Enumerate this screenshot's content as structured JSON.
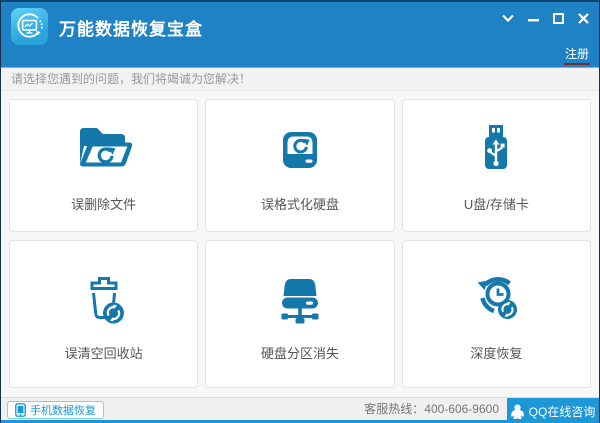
{
  "window": {
    "title": "万能数据恢复宝盒"
  },
  "titlebar": {
    "register_label": "注册",
    "controls": {
      "dropdown": "chevron-down",
      "minimize": "minimize",
      "maximize": "maximize",
      "close": "close"
    }
  },
  "notice": {
    "text": "请选择您遇到的问题，我们将竭诚为您解决！"
  },
  "cards": [
    {
      "label": "误删除文件",
      "icon": "folder-recover-icon"
    },
    {
      "label": "误格式化硬盘",
      "icon": "hdd-format-icon"
    },
    {
      "label": "U盘/存储卡",
      "icon": "usb-drive-icon"
    },
    {
      "label": "误清空回收站",
      "icon": "recycle-bin-recover-icon"
    },
    {
      "label": "硬盘分区消失",
      "icon": "partition-lost-icon"
    },
    {
      "label": "深度恢复",
      "icon": "deep-recovery-icon"
    }
  ],
  "footer": {
    "phone_button_label": "手机数据恢复",
    "hotline_label": "客服热线：400-606-9600",
    "qq_button_label": "QQ在线咨询"
  },
  "colors": {
    "titlebar_blue": "#1e82c4",
    "icon_blue": "#1478aa",
    "qq_button_blue": "#1d97d6",
    "register_underline": "#7c2a2a",
    "label_gray": "#555555",
    "notice_gray": "#999999"
  }
}
